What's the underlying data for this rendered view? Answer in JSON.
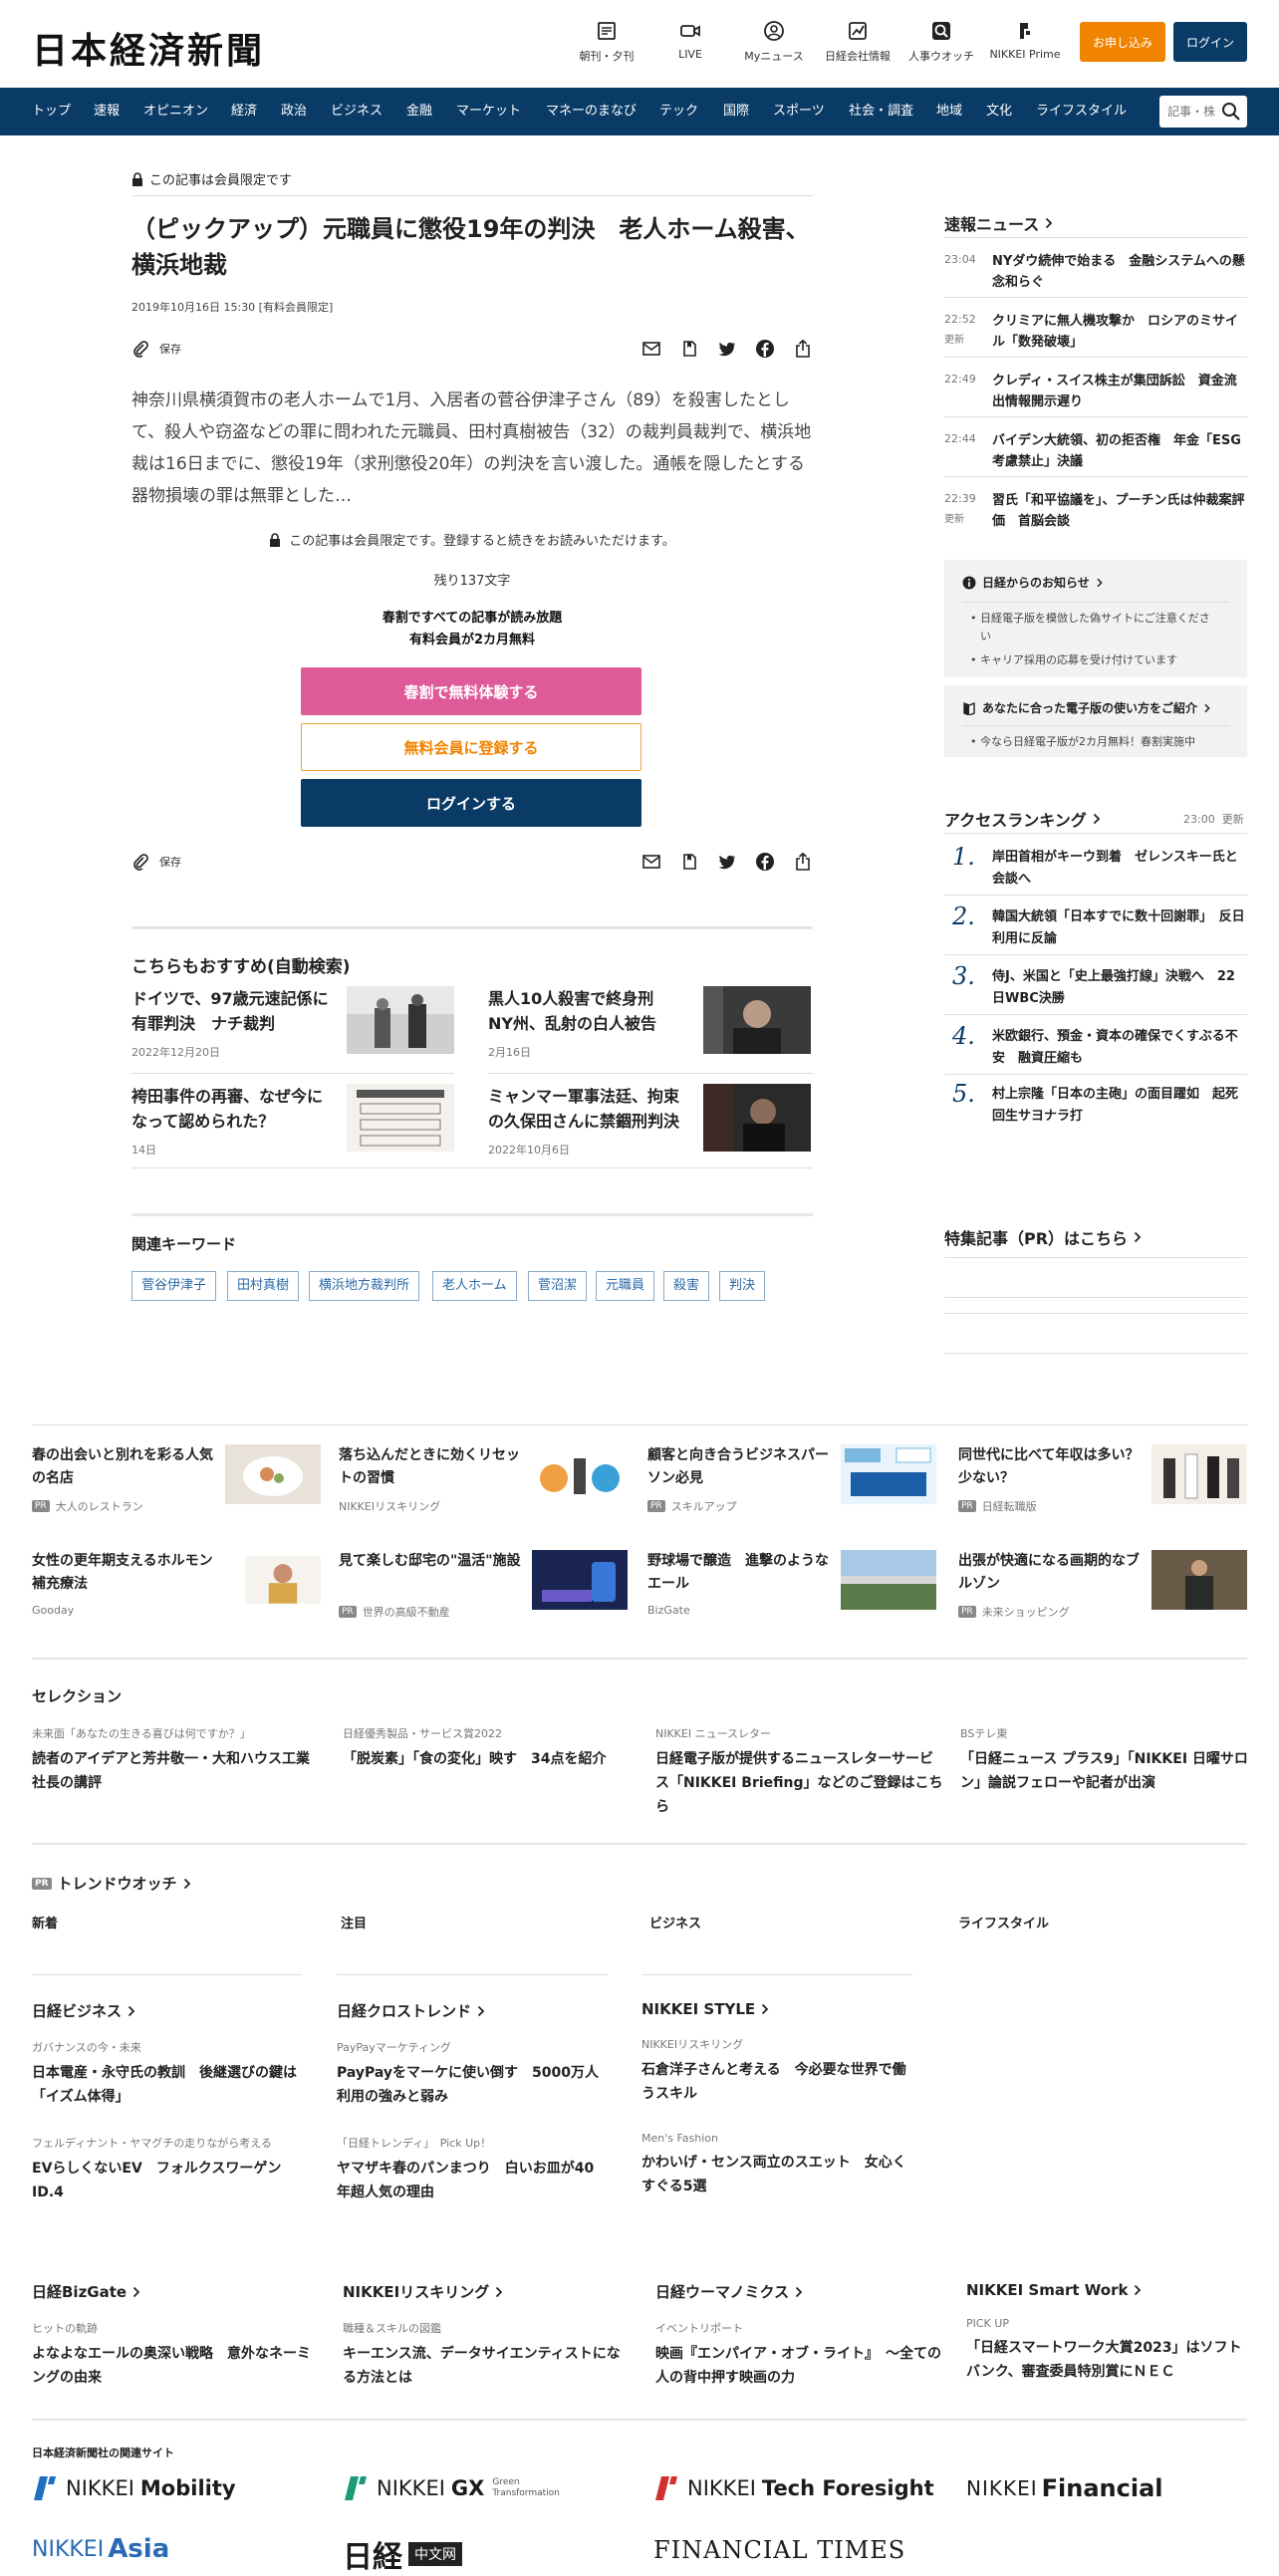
{
  "header": {
    "logo": "日本経済新聞",
    "icons": [
      {
        "label": "朝刊・夕刊",
        "icon": "newspaper-icon"
      },
      {
        "label": "LIVE",
        "icon": "video-icon"
      },
      {
        "label": "Myニュース",
        "icon": "user-icon"
      },
      {
        "label": "日経会社情報",
        "icon": "chart-icon"
      },
      {
        "label": "人事ウオッチ",
        "icon": "search-person-icon"
      },
      {
        "label": "NIKKEI Prime",
        "icon": "prime-icon"
      }
    ],
    "apply_label": "お申し込み",
    "login_label": "ログイン",
    "apply_color": "#f08300",
    "brand_color": "#0a3b67"
  },
  "nav": {
    "items": [
      "トップ",
      "速報",
      "オピニオン",
      "経済",
      "政治",
      "ビジネス",
      "金融",
      "マーケット",
      "マネーのまなび",
      "テック",
      "国際",
      "スポーツ",
      "社会・調査",
      "地域",
      "文化",
      "ライフスタイル"
    ],
    "search_placeholder": "記事・株"
  },
  "article": {
    "member_only": "この記事は会員限定です",
    "title": "（ピックアップ）元職員に懲役19年の判決　老人ホーム殺害、横浜地裁",
    "date": "2019年10月16日 15:30 [有料会員限定]",
    "save_label": "保存",
    "lead": "神奈川県横須賀市の老人ホームで1月、入居者の菅谷伊津子さん（89）を殺害したとして、殺人や窃盗などの罪に問われた元職員、田村真樹被告（32）の裁判員裁判で、横浜地裁は16日までに、懲役19年（求刑懲役20年）の判決を言い渡した。通帳を隠したとする器物損壊の罪は無罪とした…",
    "member_note": "この記事は会員限定です。登録すると続きをお読みいただけます。",
    "remaining": "残り137文字",
    "promo_line1": "春割ですべての記事が読み放題",
    "promo_line2": "有料会員が2カ月無料",
    "cta_trial": "春割で無料体験する",
    "cta_register": "無料会員に登録する",
    "cta_login": "ログインする",
    "cta_trial_color": "#df5a99"
  },
  "recommend": {
    "heading": "こちらもおすすめ(自動検索)",
    "items": [
      {
        "title": "ドイツで、97歳元速記係に有罪判決　ナチ裁判",
        "date": "2022年12月20日"
      },
      {
        "title": "黒人10人殺害で終身刑　NY州、乱射の白人被告",
        "date": "2月16日"
      },
      {
        "title": "袴田事件の再審、なぜ今になって認められた？",
        "date": "14日"
      },
      {
        "title": "ミャンマー軍事法廷、拘束の久保田さんに禁錮刑判決",
        "date": "2022年10月6日"
      }
    ]
  },
  "keywords": {
    "heading": "関連キーワード",
    "items": [
      "菅谷伊津子",
      "田村真樹",
      "横浜地方裁判所",
      "老人ホーム",
      "菅沼潔",
      "元職員",
      "殺害",
      "判決"
    ]
  },
  "sidebar": {
    "flash_heading": "速報ニュース",
    "flash": [
      {
        "time": "23:04",
        "updated": "",
        "title": "NYダウ続伸で始まる　金融システムへの懸念和らぐ"
      },
      {
        "time": "22:52",
        "updated": "更新",
        "title": "クリミアに無人機攻撃か　ロシアのミサイル「数発破壊」"
      },
      {
        "time": "22:49",
        "updated": "",
        "title": "クレディ・スイス株主が集団訴訟　資金流出情報開示遅り"
      },
      {
        "time": "22:44",
        "updated": "",
        "title": "バイデン大統領、初の拒否権　年金「ESG考慮禁止」決議"
      },
      {
        "time": "22:39",
        "updated": "更新",
        "title": "習氏「和平協議を」、プーチン氏は仲裁案評価　首脳会談"
      }
    ],
    "notice_heading": "日経からのお知らせ",
    "notices": [
      "日経電子版を模倣した偽サイトにご注意ください",
      "キャリア採用の応募を受け付けています"
    ],
    "guide_heading": "あなたに合った電子版の使い方をご紹介",
    "guides": [
      "今なら日経電子版が2カ月無料！春割実施中"
    ],
    "ranking_heading": "アクセスランキング",
    "ranking_time": "23:00  更新",
    "ranking": [
      {
        "n": "1.",
        "title": "岸田首相がキーウ到着　ゼレンスキー氏と会談へ"
      },
      {
        "n": "2.",
        "title": "韓国大統領「日本すでに数十回謝罪」　反日利用に反論"
      },
      {
        "n": "3.",
        "title": "侍J、米国と「史上最強打線」決戦へ　22日WBC決勝"
      },
      {
        "n": "4.",
        "title": "米欧銀行、預金・資本の確保でくすぶる不安　融資圧縮も"
      },
      {
        "n": "5.",
        "title": "村上宗隆「日本の主砲」の面目躍如　起死回生サヨナラ打"
      }
    ],
    "pr_heading": "特集記事（PR）はこちら"
  },
  "pr_grid": {
    "badge": "PR",
    "items": [
      {
        "title": "春の出会いと別れを彩る人気の名店",
        "source": "大人のレストラン",
        "pr": true
      },
      {
        "title": "落ち込んだときに効くリセットの習慣",
        "source": "NIKKEIリスキリング",
        "pr": false
      },
      {
        "title": "顧客と向き合うビジネスパーソン必見",
        "source": "スキルアップ",
        "pr": true
      },
      {
        "title": "同世代に比べて年収は多い？少ない？",
        "source": "日経転職版",
        "pr": true
      },
      {
        "title": "女性の更年期支えるホルモン補充療法",
        "source": "Gooday",
        "pr": false
      },
      {
        "title": "見て楽しむ邸宅の\"温活\"施設",
        "source": "世界の高級不動産",
        "pr": true
      },
      {
        "title": "野球場で醸造　進撃のようなエール",
        "source": "BizGate",
        "pr": false
      },
      {
        "title": "出張が快適になる画期的なブルゾン",
        "source": "未来ショッピング",
        "pr": true
      }
    ]
  },
  "selection": {
    "heading": "セレクション",
    "items": [
      {
        "category": "未来面「あなたの生きる喜びは何ですか？」",
        "title": "読者のアイデアと芳井敬一・大和ハウス工業社長の講評"
      },
      {
        "category": "日経優秀製品・サービス賞2022",
        "title": "「脱炭素」「食の変化」映す　34点を紹介"
      },
      {
        "category": "NIKKEI ニュースレター",
        "title": "日経電子版が提供するニュースレターサービス「NIKKEI Briefing」などのご登録はこちら"
      },
      {
        "category": "BSテレ東",
        "title": "「日経ニュース プラス9」「NIKKEI 日曜サロン」論説フェローや記者が出演"
      }
    ]
  },
  "trend": {
    "heading": "トレンドウオッチ",
    "tabs": [
      "新着",
      "注目",
      "ビジネス",
      "ライフスタイル"
    ],
    "groups": [
      {
        "name": "日経ビジネス",
        "items": [
          {
            "category": "ガバナンスの今・未来",
            "title": "日本電産・永守氏の教訓　後継選びの鍵は「イズム体得」"
          },
          {
            "category": "フェルディナント・ヤマグチの走りながら考える",
            "title": "EVらしくないEV　フォルクスワーゲンID.4"
          }
        ]
      },
      {
        "name": "日経クロストレンド",
        "items": [
          {
            "category": "PayPayマーケティング",
            "title": "PayPayをマーケに使い倒す　5000万人利用の強みと弱み"
          },
          {
            "category": "「日経トレンディ」　Pick Up！",
            "title": "ヤマザキ春のパンまつり　白いお皿が40年超人気の理由"
          }
        ]
      },
      {
        "name": "NIKKEI STYLE",
        "items": [
          {
            "category": "NIKKEIリスキリング",
            "title": "石倉洋子さんと考える　今必要な世界で働うスキル"
          },
          {
            "category": "Men's Fashion",
            "title": "かわいげ・センス両立のスエット　女心くすぐる5選"
          }
        ]
      }
    ],
    "groups2": [
      {
        "name": "日経BizGate",
        "items": [
          {
            "category": "ヒットの軌跡",
            "title": "よなよなエールの奥深い戦略　意外なネーミングの由来"
          }
        ]
      },
      {
        "name": "NIKKEIリスキリング",
        "items": [
          {
            "category": "職種＆スキルの図鑑",
            "title": "キーエンス流、データサイエンティストになる方法とは"
          }
        ]
      },
      {
        "name": "日経ウーマノミクス",
        "items": [
          {
            "category": "イベントリポート",
            "title": "映画『エンパイア・オブ・ライト』　～全ての人の背中押す映画の力"
          }
        ]
      },
      {
        "name": "NIKKEI Smart Work",
        "items": [
          {
            "category": "PICK UP",
            "title": "「日経スマートワーク大賞2023」はソフトバンク、審査委員特別賞にＮＥＣ"
          }
        ]
      }
    ]
  },
  "related": {
    "heading": "日本経済新聞社の関連サイト",
    "logos": [
      {
        "name": "NIKKEI Mobility",
        "brand": "NIKKEI",
        "sub": "Mobility",
        "extra": "",
        "color": "#1f6fc2"
      },
      {
        "name": "NIKKEI GX",
        "brand": "NIKKEI",
        "sub": "GX",
        "extra": "Green Transformation",
        "color": "#1a9b77"
      },
      {
        "name": "NIKKEI Tech Foresight",
        "brand": "NIKKEI",
        "sub": "Tech Foresight",
        "extra": "",
        "color": "#d33030"
      },
      {
        "name": "NIKKEI Financial",
        "brand": "NIKKEI",
        "sub": "Financial",
        "extra": "",
        "color": "#111111"
      },
      {
        "name": "NIKKEI Asia",
        "brand": "NIKKEI",
        "sub": "Asia",
        "extra": "",
        "color": "#2a6ab5"
      },
      {
        "name": "日経中文网",
        "brand": "日経",
        "sub": "中文网",
        "extra": "",
        "color": "#222222"
      },
      {
        "name": "FINANCIAL TIMES",
        "brand": "FINANCIAL TIMES",
        "sub": "",
        "extra": "",
        "color": "#111111"
      }
    ]
  }
}
